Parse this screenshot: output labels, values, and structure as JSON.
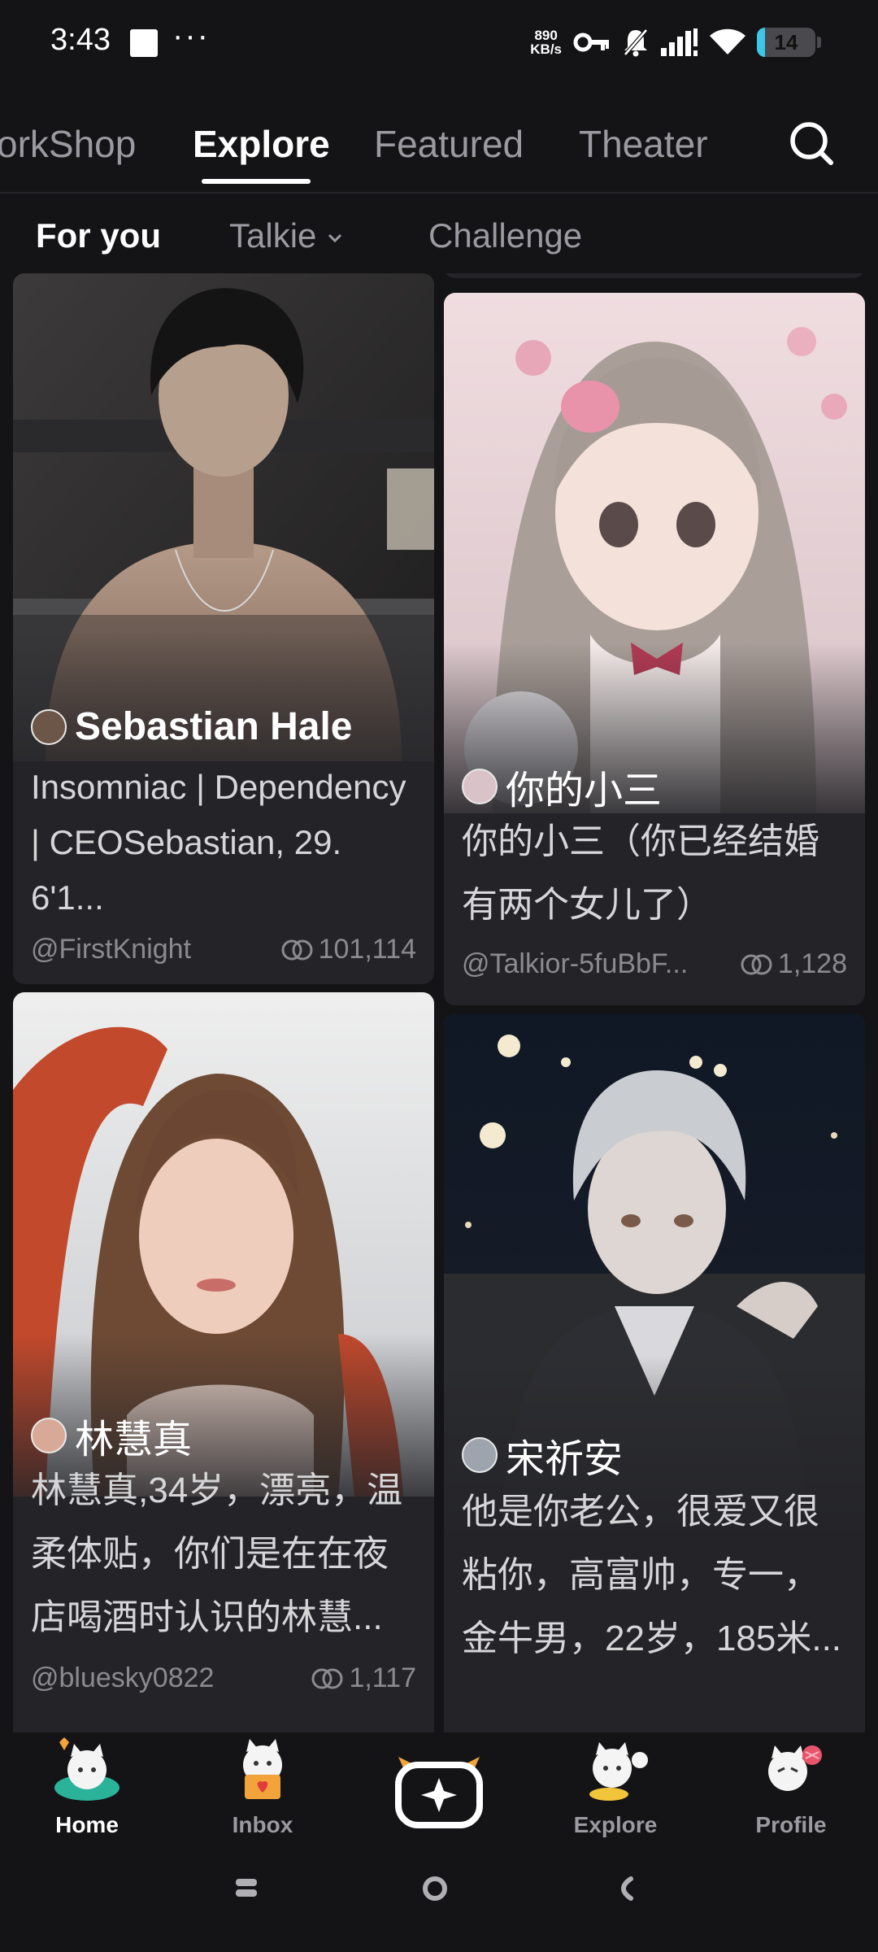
{
  "status_bar": {
    "time": "3:43",
    "more": "···",
    "speed_value": "890",
    "speed_unit": "KB/s",
    "battery": "14",
    "battery_level": 0.14
  },
  "top_tabs": [
    {
      "label": "orkShop"
    },
    {
      "label": "Explore",
      "active": true
    },
    {
      "label": "Featured"
    },
    {
      "label": "Theater"
    }
  ],
  "sub_tabs": {
    "for_you": "For you",
    "talkie": "Talkie",
    "challenge": "Challenge"
  },
  "cards": [
    {
      "name": "Sebastian Hale",
      "description": "Insomniac | Dependency | CEOSebastian, 29. 6'1...",
      "author": "@FirstKnight",
      "count": "101,114"
    },
    {
      "name": "你的小三",
      "description": "你的小三（你已经结婚有两个女儿了）",
      "author": "@Talkior-5fuBbF...",
      "count": "1,128"
    },
    {
      "name": "林慧真",
      "description": "林慧真,34岁，漂亮，温柔体贴，你们是在在夜店喝酒时认识的林慧...",
      "author": "@bluesky0822",
      "count": "1,117"
    },
    {
      "name": "宋祈安",
      "description": "他是你老公，很爱又很粘你，高富帅，专一，金牛男，22岁，185米...",
      "author": "",
      "count": ""
    }
  ],
  "bottom_nav": {
    "home": "Home",
    "inbox": "Inbox",
    "explore": "Explore",
    "profile": "Profile"
  },
  "colors": {
    "background": "#141416",
    "card": "#242428",
    "accent_orange": "#f2a43a",
    "battery_fill": "#3cc6e8"
  }
}
